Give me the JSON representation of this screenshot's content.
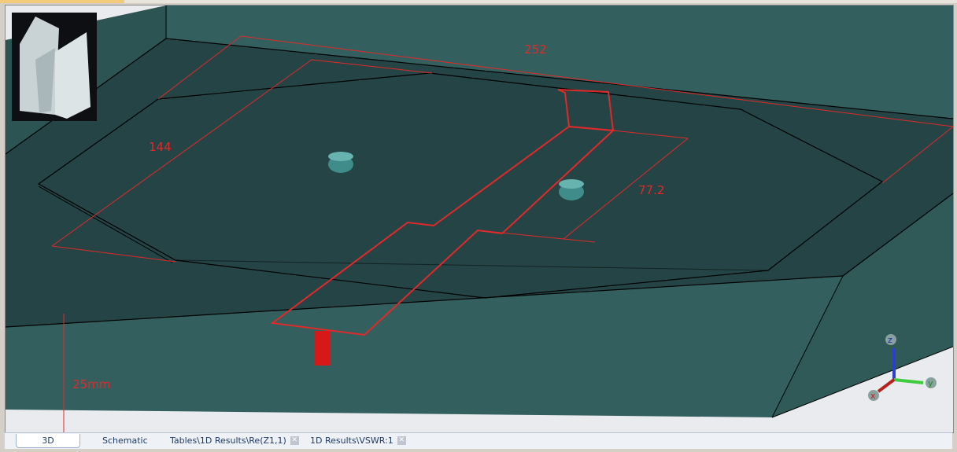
{
  "dimensions": {
    "length": "252",
    "width": "144",
    "feed_width": "77.2",
    "height": "25mm"
  },
  "axes": {
    "z": "z",
    "y": "y",
    "x": "x"
  },
  "tabs": [
    {
      "label": "3D",
      "active": true
    },
    {
      "label": "Schematic",
      "active": false
    },
    {
      "label": "Tables\\1D Results\\Re(Z1,1)",
      "active": false,
      "closable": true
    },
    {
      "label": "1D Results\\VSWR:1",
      "active": false,
      "closable": true
    }
  ],
  "colors": {
    "floor": "#254445",
    "wall": "#33605e",
    "dimension": "#e02a2a"
  }
}
